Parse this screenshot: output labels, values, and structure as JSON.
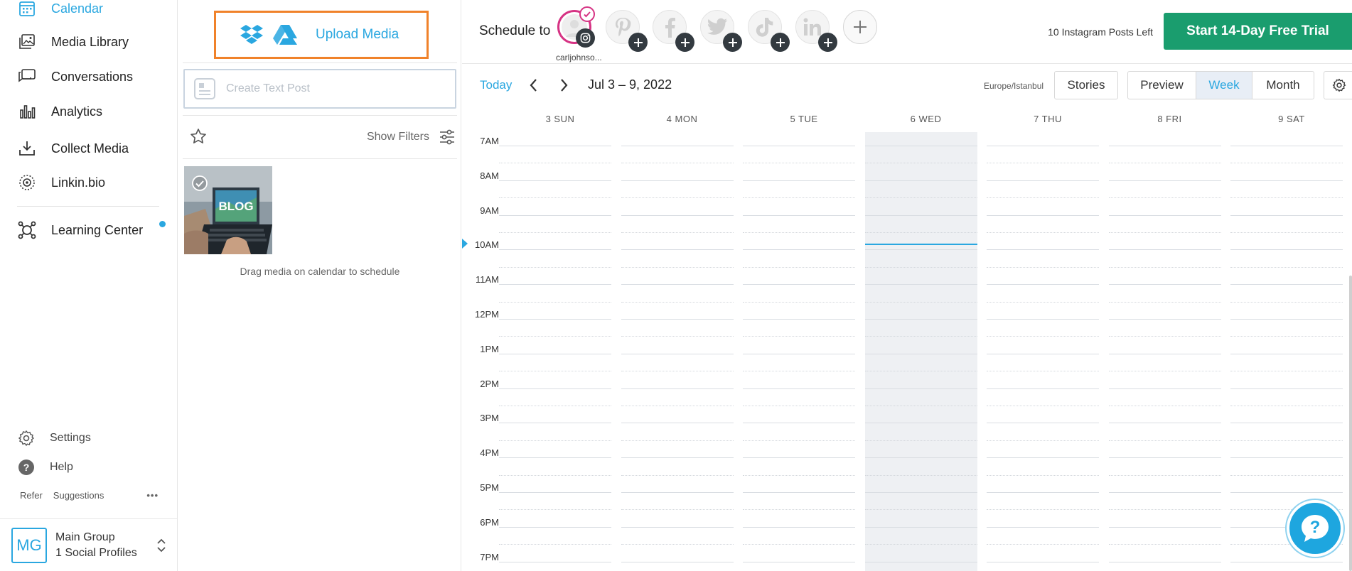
{
  "nav": {
    "items": [
      {
        "label": "Calendar",
        "icon": "calendar-icon",
        "active": true
      },
      {
        "label": "Media Library",
        "icon": "image-icon"
      },
      {
        "label": "Conversations",
        "icon": "chat-icon"
      },
      {
        "label": "Analytics",
        "icon": "bar-chart-icon"
      },
      {
        "label": "Collect Media",
        "icon": "download-icon"
      },
      {
        "label": "Linkin.bio",
        "icon": "link-bio-icon"
      },
      {
        "label": "Learning Center",
        "icon": "learning-icon"
      }
    ],
    "settings_label": "Settings",
    "help_label": "Help",
    "refer_label": "Refer",
    "suggestions_label": "Suggestions",
    "more_label": "•••",
    "group": {
      "initials": "MG",
      "name": "Main Group",
      "sub": "1 Social Profiles"
    }
  },
  "media": {
    "upload_label": "Upload Media",
    "text_post_placeholder": "Create Text Post",
    "filters_label": "Show Filters",
    "thumb_text": "BLOG",
    "drag_hint": "Drag media on calendar to schedule"
  },
  "topbar": {
    "schedule_label": "Schedule to",
    "instagram_handle": "carljohnso...",
    "posts_left": "10 Instagram Posts Left",
    "trial_label": "Start 14-Day Free Trial"
  },
  "calendar": {
    "today_label": "Today",
    "range": "Jul 3 – 9, 2022",
    "timezone": "Europe/Istanbul",
    "stories_label": "Stories",
    "preview_label": "Preview",
    "week_label": "Week",
    "month_label": "Month",
    "active_view": "Week",
    "days": [
      "3 SUN",
      "4 MON",
      "5 TUE",
      "6 WED",
      "7 THU",
      "8 FRI",
      "9 SAT"
    ],
    "hours": [
      "7AM",
      "8AM",
      "9AM",
      "10AM",
      "11AM",
      "12PM",
      "1PM",
      "2PM",
      "3PM",
      "4PM",
      "5PM",
      "6PM",
      "7PM"
    ]
  },
  "colors": {
    "accent": "#2aa7e0",
    "trial": "#1a9d6e",
    "highlight": "#f0822a",
    "instagram": "#d63384"
  }
}
